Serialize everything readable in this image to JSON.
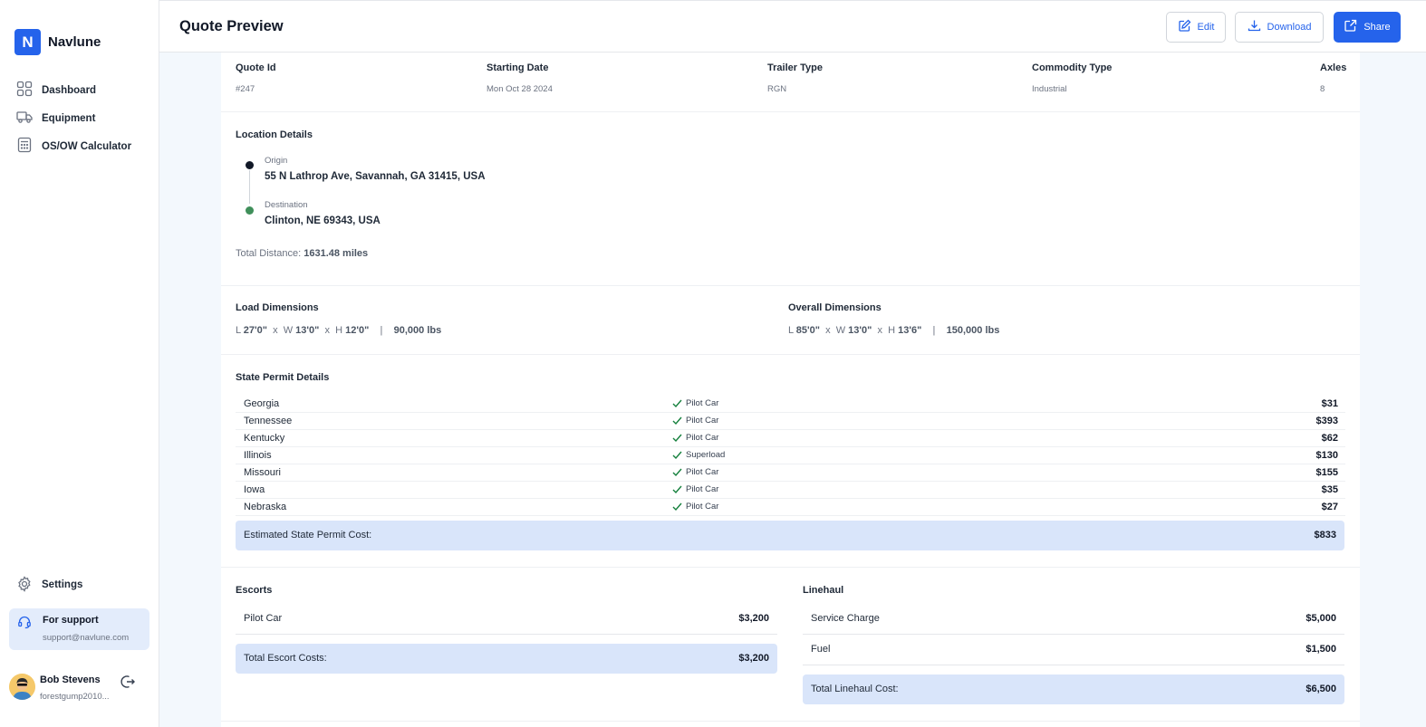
{
  "sidebar": {
    "brand_letter": "N",
    "brand_name": "Navlune",
    "nav": [
      {
        "label": "Dashboard",
        "icon": "grid-icon"
      },
      {
        "label": "Equipment",
        "icon": "truck-icon"
      },
      {
        "label": "OS/OW Calculator",
        "icon": "calculator-icon"
      }
    ],
    "settings_label": "Settings",
    "support": {
      "title": "For support",
      "email": "support@navlune.com"
    },
    "user": {
      "name": "Bob Stevens",
      "email": "forestgump2010..."
    }
  },
  "header": {
    "title": "Quote Preview",
    "edit_label": "Edit",
    "download_label": "Download",
    "share_label": "Share"
  },
  "quote": {
    "headers": [
      "Quote Id",
      "Starting Date",
      "Trailer Type",
      "Commodity Type",
      "Axles"
    ],
    "values": [
      "#247",
      "Mon Oct 28 2024",
      "RGN",
      "Industrial",
      "8"
    ]
  },
  "location": {
    "title": "Location Details",
    "origin_caption": "Origin",
    "origin": "55 N Lathrop Ave, Savannah, GA 31415, USA",
    "destination_caption": "Destination",
    "destination": "Clinton, NE 69343, USA",
    "distance_label": "Total Distance:",
    "distance_value": "1631.48 miles"
  },
  "dimensions": {
    "load": {
      "title": "Load Dimensions",
      "l": "27'0\"",
      "w": "13'0\"",
      "h": "12'0\"",
      "weight": "90,000 lbs"
    },
    "overall": {
      "title": "Overall Dimensions",
      "l": "85'0\"",
      "w": "13'0\"",
      "h": "13'6\"",
      "weight": "150,000 lbs"
    },
    "l_prefix": "L",
    "w_prefix": "W",
    "h_prefix": "H",
    "x_sep": "x",
    "pipe": "|"
  },
  "permits": {
    "title": "State Permit Details",
    "rows": [
      {
        "state": "Georgia",
        "type": "Pilot Car",
        "amount": "$31"
      },
      {
        "state": "Tennessee",
        "type": "Pilot Car",
        "amount": "$393"
      },
      {
        "state": "Kentucky",
        "type": "Pilot Car",
        "amount": "$62"
      },
      {
        "state": "Illinois",
        "type": "Superload",
        "amount": "$130"
      },
      {
        "state": "Missouri",
        "type": "Pilot Car",
        "amount": "$155"
      },
      {
        "state": "Iowa",
        "type": "Pilot Car",
        "amount": "$35"
      },
      {
        "state": "Nebraska",
        "type": "Pilot Car",
        "amount": "$27"
      }
    ],
    "total_label": "Estimated State Permit Cost:",
    "total_amount": "$833"
  },
  "escorts": {
    "title": "Escorts",
    "items": [
      {
        "label": "Pilot Car",
        "amount": "$3,200"
      }
    ],
    "total_label": "Total Escort Costs:",
    "total_amount": "$3,200"
  },
  "linehaul": {
    "title": "Linehaul",
    "items": [
      {
        "label": "Service Charge",
        "amount": "$5,000"
      },
      {
        "label": "Fuel",
        "amount": "$1,500"
      }
    ],
    "total_label": "Total Linehaul Cost:",
    "total_amount": "$6,500"
  },
  "colors": {
    "accent": "#2563eb",
    "total_bg": "#d9e5fa",
    "origin_dot": "#111827",
    "destination_dot": "#3f8f5a",
    "check": "#15803d"
  }
}
